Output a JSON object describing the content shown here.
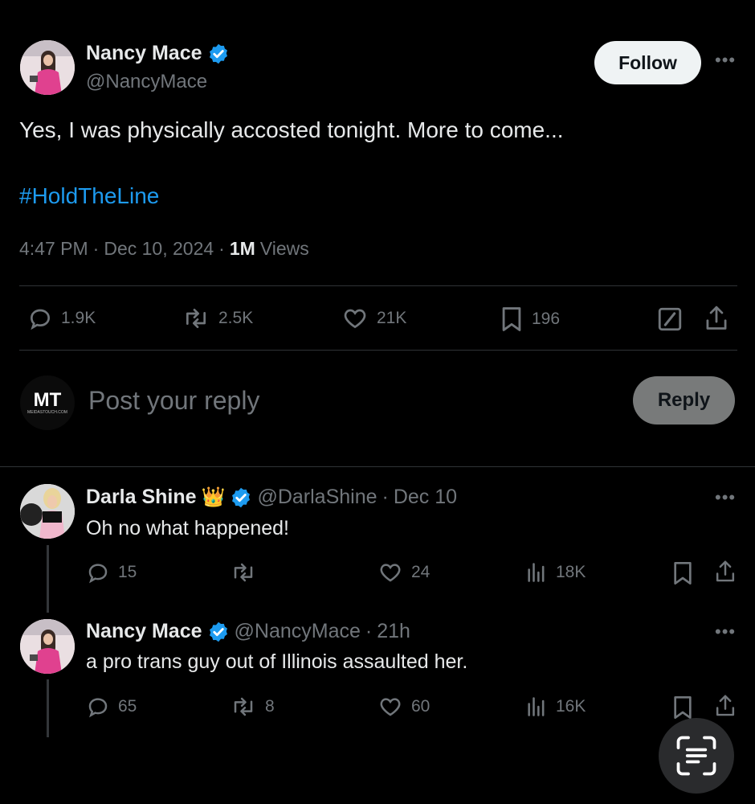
{
  "main_tweet": {
    "author_name": "Nancy Mace",
    "handle": "@NancyMace",
    "follow_label": "Follow",
    "text": "Yes, I was physically accosted tonight. More to come...",
    "hashtag": "#HoldTheLine",
    "time": "4:47 PM",
    "date": "Dec 10, 2024",
    "views_count": "1M",
    "views_label": "Views",
    "stats": {
      "replies": "1.9K",
      "reposts": "2.5K",
      "likes": "21K",
      "bookmarks": "196"
    }
  },
  "composer": {
    "avatar_text": "MT",
    "avatar_subtext": "MEIDASTOUCH.COM",
    "placeholder": "Post your reply",
    "reply_label": "Reply"
  },
  "replies": [
    {
      "author_name": "Darla Shine",
      "badge_emoji": "👑",
      "handle": "@DarlaShine",
      "time": "Dec 10",
      "text": "Oh no what happened!",
      "stats": {
        "replies": "15",
        "reposts": "",
        "likes": "24",
        "views": "18K"
      }
    },
    {
      "author_name": "Nancy Mace",
      "handle": "@NancyMace",
      "time": "21h",
      "text": "a pro trans guy out of Illinois assaulted her.",
      "stats": {
        "replies": "65",
        "reposts": "8",
        "likes": "60",
        "views": "16K"
      }
    }
  ],
  "colors": {
    "background": "#000000",
    "text": "#e7e9ea",
    "secondary": "#71767b",
    "link": "#1d9bf0",
    "verified": "#1d9bf0",
    "divider": "#2f3336"
  }
}
